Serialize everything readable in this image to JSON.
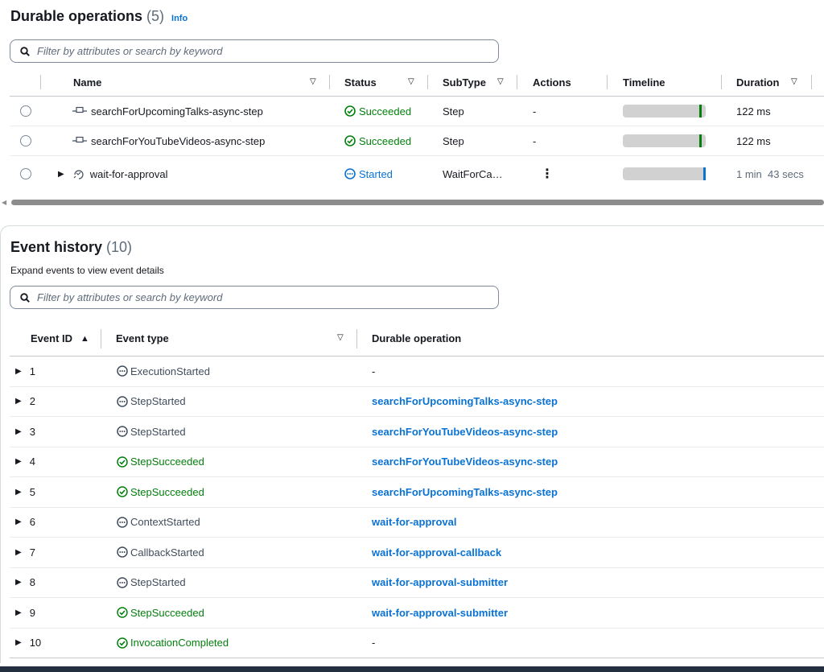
{
  "durable_operations": {
    "title": "Durable operations",
    "count": "(5)",
    "info": "Info",
    "search_placeholder": "Filter by attributes or search by keyword",
    "columns": {
      "name": "Name",
      "status": "Status",
      "subtype": "SubType",
      "actions": "Actions",
      "timeline": "Timeline",
      "duration": "Duration"
    },
    "rows": [
      {
        "name": "searchForUpcomingTalks-async-step",
        "status": "Succeeded",
        "subtype": "Step",
        "actions": "-",
        "duration": "122 ms"
      },
      {
        "name": "searchForYouTubeVideos-async-step",
        "status": "Succeeded",
        "subtype": "Step",
        "actions": "-",
        "duration": "122 ms"
      },
      {
        "name": "wait-for-approval",
        "status": "Started",
        "subtype": "WaitForCa…",
        "actions": "⋮",
        "duration": "1 min  43 secs"
      }
    ]
  },
  "event_history": {
    "title": "Event history",
    "count": "(10)",
    "subtitle": "Expand events to view event details",
    "search_placeholder": "Filter by attributes or search by keyword",
    "columns": {
      "event_id": "Event ID",
      "event_type": "Event type",
      "durable_operation": "Durable operation"
    },
    "rows": [
      {
        "id": "1",
        "type": "ExecutionStarted",
        "op": "-"
      },
      {
        "id": "2",
        "type": "StepStarted",
        "op": "searchForUpcomingTalks-async-step"
      },
      {
        "id": "3",
        "type": "StepStarted",
        "op": "searchForYouTubeVideos-async-step"
      },
      {
        "id": "4",
        "type": "StepSucceeded",
        "op": "searchForYouTubeVideos-async-step"
      },
      {
        "id": "5",
        "type": "StepSucceeded",
        "op": "searchForUpcomingTalks-async-step"
      },
      {
        "id": "6",
        "type": "ContextStarted",
        "op": "wait-for-approval"
      },
      {
        "id": "7",
        "type": "CallbackStarted",
        "op": "wait-for-approval-callback"
      },
      {
        "id": "8",
        "type": "StepStarted",
        "op": "wait-for-approval-submitter"
      },
      {
        "id": "9",
        "type": "StepSucceeded",
        "op": "wait-for-approval-submitter"
      },
      {
        "id": "10",
        "type": "InvocationCompleted",
        "op": "-"
      }
    ]
  },
  "colors": {
    "success": "#037f0c",
    "link": "#0972d3",
    "neutral": "#414d5c"
  }
}
